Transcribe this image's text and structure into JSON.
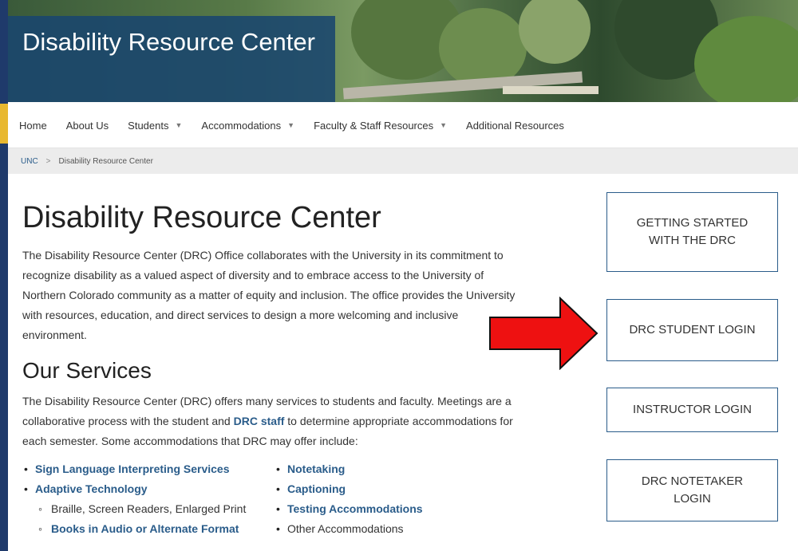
{
  "hero": {
    "title": "Disability Resource Center"
  },
  "nav": {
    "items": [
      {
        "label": "Home",
        "dropdown": false
      },
      {
        "label": "About Us",
        "dropdown": false
      },
      {
        "label": "Students",
        "dropdown": true
      },
      {
        "label": "Accommodations",
        "dropdown": true
      },
      {
        "label": "Faculty & Staff Resources",
        "dropdown": true
      },
      {
        "label": "Additional Resources",
        "dropdown": false
      }
    ]
  },
  "breadcrumb": {
    "root": "UNC",
    "separator": ">",
    "current": "Disability Resource Center"
  },
  "main": {
    "heading": "Disability Resource Center",
    "intro": "The Disability Resource Center (DRC) Office collaborates with the University in its commitment to recognize disability as a valued aspect of diversity and to embrace access to the University of Northern Colorado community as a matter of equity and inclusion. The office provides the University with resources, education, and direct services to design a more welcoming and inclusive environment.",
    "services_heading": "Our Services",
    "services_text_1": "The Disability Resource Center (DRC) offers many services to students and faculty. Meetings are a collaborative process with the student and ",
    "services_link": "DRC staff",
    "services_text_2": " to determine appropriate accommodations for each semester. Some accommodations that DRC may offer include:",
    "list_col1": {
      "item1": "Sign Language Interpreting Services",
      "item2": "Adaptive Technology",
      "sub1": "Braille, Screen Readers, Enlarged Print",
      "sub2": "Books in Audio or Alternate Format"
    },
    "list_col2": {
      "item1": "Notetaking",
      "item2": "Captioning",
      "item3": "Testing Accommodations",
      "item4": "Other Accommodations"
    }
  },
  "side": {
    "getting_started": "GETTING STARTED WITH THE DRC",
    "student_login": "DRC STUDENT LOGIN",
    "instructor_login": "INSTRUCTOR LOGIN",
    "notetaker_login": "DRC NOTETAKER LOGIN"
  },
  "colors": {
    "brand_navy": "#1f3a6b",
    "link_blue": "#2a5c8a",
    "arrow_red": "#ee1111",
    "gold": "#e8b830"
  }
}
